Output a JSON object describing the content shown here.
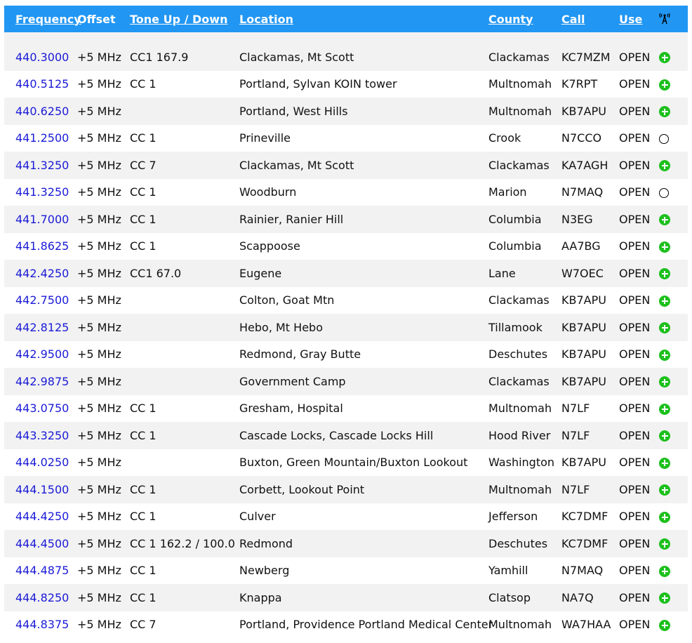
{
  "header": {
    "frequency": "Frequency",
    "offset": "Offset",
    "tone": "Tone Up / Down",
    "location": "Location",
    "county": "County",
    "call": "Call",
    "use": "Use",
    "icon": "tower-icon"
  },
  "rows": [
    {
      "frequency": "440.3000",
      "offset": "+5 MHz",
      "tone": "CC1 167.9",
      "location": "Clackamas, Mt Scott",
      "county": "Clackamas",
      "call": "KC7MZM",
      "use": "OPEN",
      "status": "plus-circle-icon"
    },
    {
      "frequency": "440.5125",
      "offset": "+5 MHz",
      "tone": "CC 1",
      "location": "Portland, Sylvan KOIN tower",
      "county": "Multnomah",
      "call": "K7RPT",
      "use": "OPEN",
      "status": "plus-circle-icon"
    },
    {
      "frequency": "440.6250",
      "offset": "+5 MHz",
      "tone": "",
      "location": "Portland, West Hills",
      "county": "Multnomah",
      "call": "KB7APU",
      "use": "OPEN",
      "status": "plus-circle-icon"
    },
    {
      "frequency": "441.2500",
      "offset": "+5 MHz",
      "tone": "CC 1",
      "location": "Prineville",
      "county": "Crook",
      "call": "N7CCO",
      "use": "OPEN",
      "status": "empty-circle-icon"
    },
    {
      "frequency": "441.3250",
      "offset": "+5 MHz",
      "tone": "CC 7",
      "location": "Clackamas, Mt Scott",
      "county": "Clackamas",
      "call": "KA7AGH",
      "use": "OPEN",
      "status": "plus-circle-icon"
    },
    {
      "frequency": "441.3250",
      "offset": "+5 MHz",
      "tone": "CC 1",
      "location": "Woodburn",
      "county": "Marion",
      "call": "N7MAQ",
      "use": "OPEN",
      "status": "empty-circle-icon"
    },
    {
      "frequency": "441.7000",
      "offset": "+5 MHz",
      "tone": "CC 1",
      "location": "Rainier, Ranier Hill",
      "county": "Columbia",
      "call": "N3EG",
      "use": "OPEN",
      "status": "plus-circle-icon"
    },
    {
      "frequency": "441.8625",
      "offset": "+5 MHz",
      "tone": "CC 1",
      "location": "Scappoose",
      "county": "Columbia",
      "call": "AA7BG",
      "use": "OPEN",
      "status": "plus-circle-icon"
    },
    {
      "frequency": "442.4250",
      "offset": "+5 MHz",
      "tone": "CC1 67.0",
      "location": "Eugene",
      "county": "Lane",
      "call": "W7OEC",
      "use": "OPEN",
      "status": "plus-circle-icon"
    },
    {
      "frequency": "442.7500",
      "offset": "+5 MHz",
      "tone": "",
      "location": "Colton, Goat Mtn",
      "county": "Clackamas",
      "call": "KB7APU",
      "use": "OPEN",
      "status": "plus-circle-icon"
    },
    {
      "frequency": "442.8125",
      "offset": "+5 MHz",
      "tone": "",
      "location": "Hebo, Mt Hebo",
      "county": "Tillamook",
      "call": "KB7APU",
      "use": "OPEN",
      "status": "plus-circle-icon"
    },
    {
      "frequency": "442.9500",
      "offset": "+5 MHz",
      "tone": "",
      "location": "Redmond, Gray Butte",
      "county": "Deschutes",
      "call": "KB7APU",
      "use": "OPEN",
      "status": "plus-circle-icon"
    },
    {
      "frequency": "442.9875",
      "offset": "+5 MHz",
      "tone": "",
      "location": "Government Camp",
      "county": "Clackamas",
      "call": "KB7APU",
      "use": "OPEN",
      "status": "plus-circle-icon"
    },
    {
      "frequency": "443.0750",
      "offset": "+5 MHz",
      "tone": "CC 1",
      "location": "Gresham, Hospital",
      "county": "Multnomah",
      "call": "N7LF",
      "use": "OPEN",
      "status": "plus-circle-icon"
    },
    {
      "frequency": "443.3250",
      "offset": "+5 MHz",
      "tone": "CC 1",
      "location": "Cascade Locks, Cascade Locks Hill",
      "county": "Hood River",
      "call": "N7LF",
      "use": "OPEN",
      "status": "plus-circle-icon"
    },
    {
      "frequency": "444.0250",
      "offset": "+5 MHz",
      "tone": "",
      "location": "Buxton, Green Mountain/Buxton Lookout",
      "county": "Washington",
      "call": "KB7APU",
      "use": "OPEN",
      "status": "plus-circle-icon"
    },
    {
      "frequency": "444.1500",
      "offset": "+5 MHz",
      "tone": "CC 1",
      "location": "Corbett, Lookout Point",
      "county": "Multnomah",
      "call": "N7LF",
      "use": "OPEN",
      "status": "plus-circle-icon"
    },
    {
      "frequency": "444.4250",
      "offset": "+5 MHz",
      "tone": "CC 1",
      "location": "Culver",
      "county": "Jefferson",
      "call": "KC7DMF",
      "use": "OPEN",
      "status": "plus-circle-icon"
    },
    {
      "frequency": "444.4500",
      "offset": "+5 MHz",
      "tone": "CC 1 162.2 / 100.0",
      "location": "Redmond",
      "county": "Deschutes",
      "call": "KC7DMF",
      "use": "OPEN",
      "status": "plus-circle-icon"
    },
    {
      "frequency": "444.4875",
      "offset": "+5 MHz",
      "tone": "CC 1",
      "location": "Newberg",
      "county": "Yamhill",
      "call": "N7MAQ",
      "use": "OPEN",
      "status": "plus-circle-icon"
    },
    {
      "frequency": "444.8250",
      "offset": "+5 MHz",
      "tone": "CC 1",
      "location": "Knappa",
      "county": "Clatsop",
      "call": "NA7Q",
      "use": "OPEN",
      "status": "plus-circle-icon"
    },
    {
      "frequency": "444.8375",
      "offset": "+5 MHz",
      "tone": "CC 7",
      "location": "Portland, Providence Portland Medical Center",
      "county": "Multnomah",
      "call": "WA7HAA",
      "use": "OPEN",
      "status": "plus-circle-icon"
    }
  ],
  "colors": {
    "header_bg": "#2196f3",
    "link": "#1a1ad6",
    "open": "#43c443",
    "status_on": "#1dc01d"
  }
}
